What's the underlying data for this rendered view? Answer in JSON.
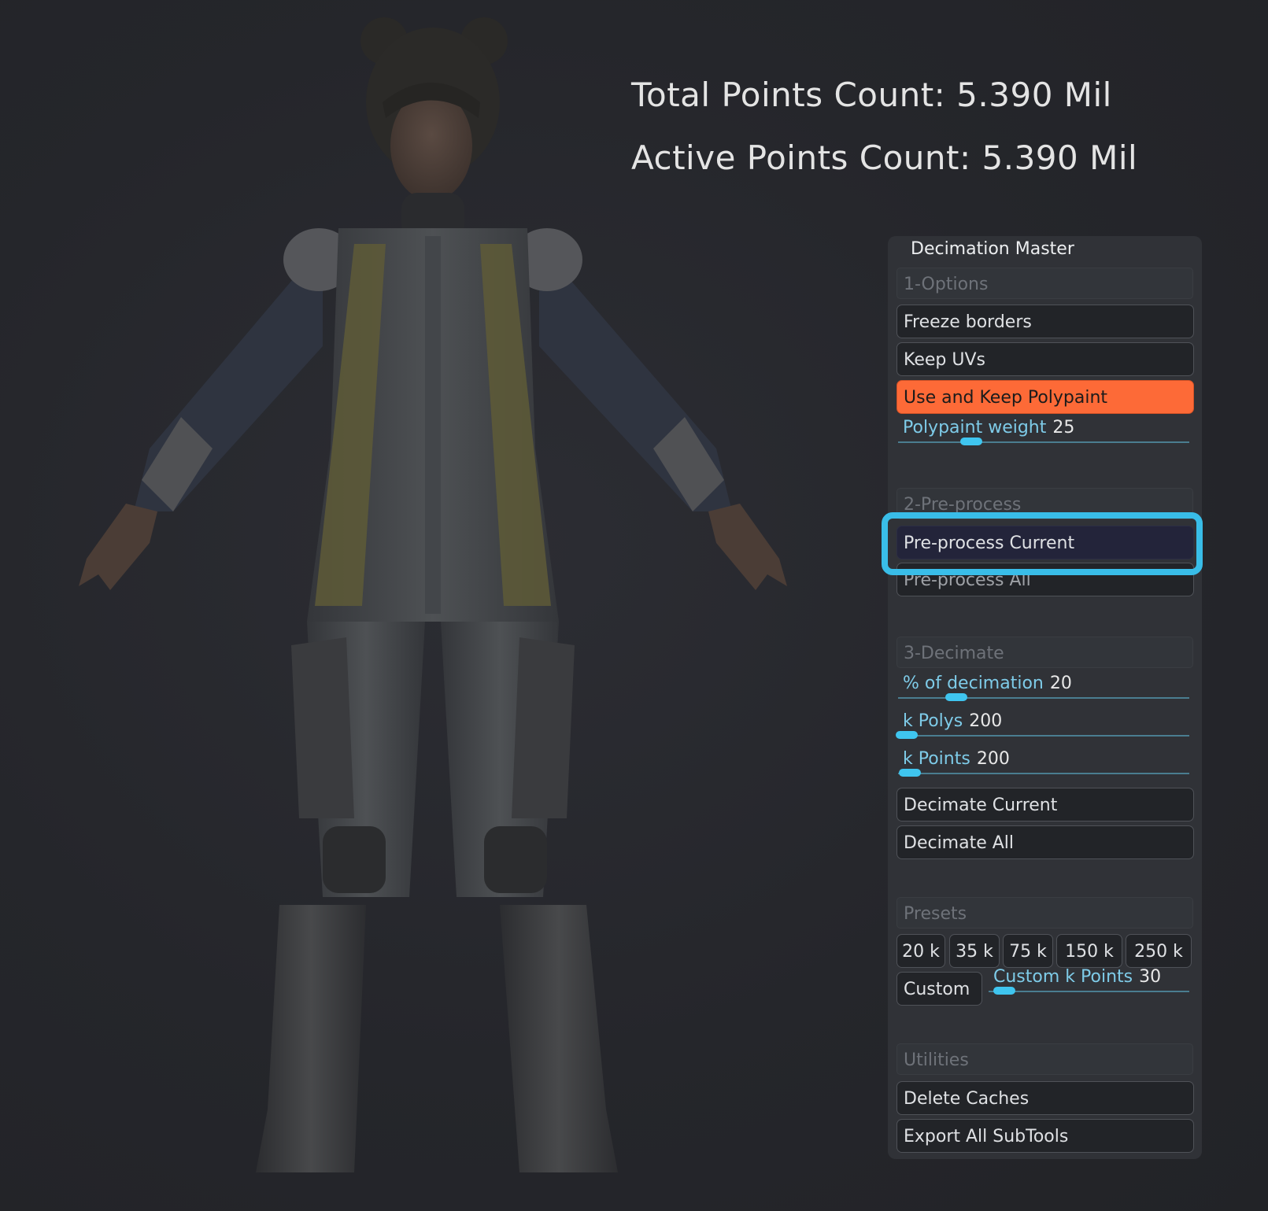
{
  "stats": {
    "total": "Total Points Count: 5.390 Mil",
    "active": "Active Points Count: 5.390 Mil"
  },
  "panel": {
    "title": "Decimation Master",
    "options": {
      "header": "1-Options",
      "freeze_borders": "Freeze borders",
      "keep_uvs": "Keep UVs",
      "use_keep_polypaint": "Use and Keep Polypaint",
      "polypaint_weight": {
        "label": "Polypaint weight",
        "value": "25",
        "fraction": 0.25
      }
    },
    "preprocess": {
      "header": "2-Pre-process",
      "current": "Pre-process Current",
      "all": "Pre-process All"
    },
    "decimate": {
      "header": "3-Decimate",
      "percent": {
        "label": "% of decimation",
        "value": "20",
        "fraction": 0.2
      },
      "k_polys": {
        "label": "k Polys",
        "value": "200",
        "fraction": 0.03
      },
      "k_points": {
        "label": "k Points",
        "value": "200",
        "fraction": 0.04
      },
      "current": "Decimate Current",
      "all": "Decimate All"
    },
    "presets": {
      "header": "Presets",
      "items": [
        "20 k",
        "35 k",
        "75 k",
        "150 k",
        "250 k"
      ],
      "custom": "Custom",
      "custom_k_points": {
        "label": "Custom k Points",
        "value": "30",
        "fraction": 0.08
      }
    },
    "utilities": {
      "header": "Utilities",
      "delete_caches": "Delete Caches",
      "export_all": "Export All SubTools"
    }
  },
  "colors": {
    "accent": "#fd6a37",
    "highlight": "#39bde8",
    "slider": "#3fc5ef",
    "panel": "#303237",
    "background": "#26272c"
  }
}
